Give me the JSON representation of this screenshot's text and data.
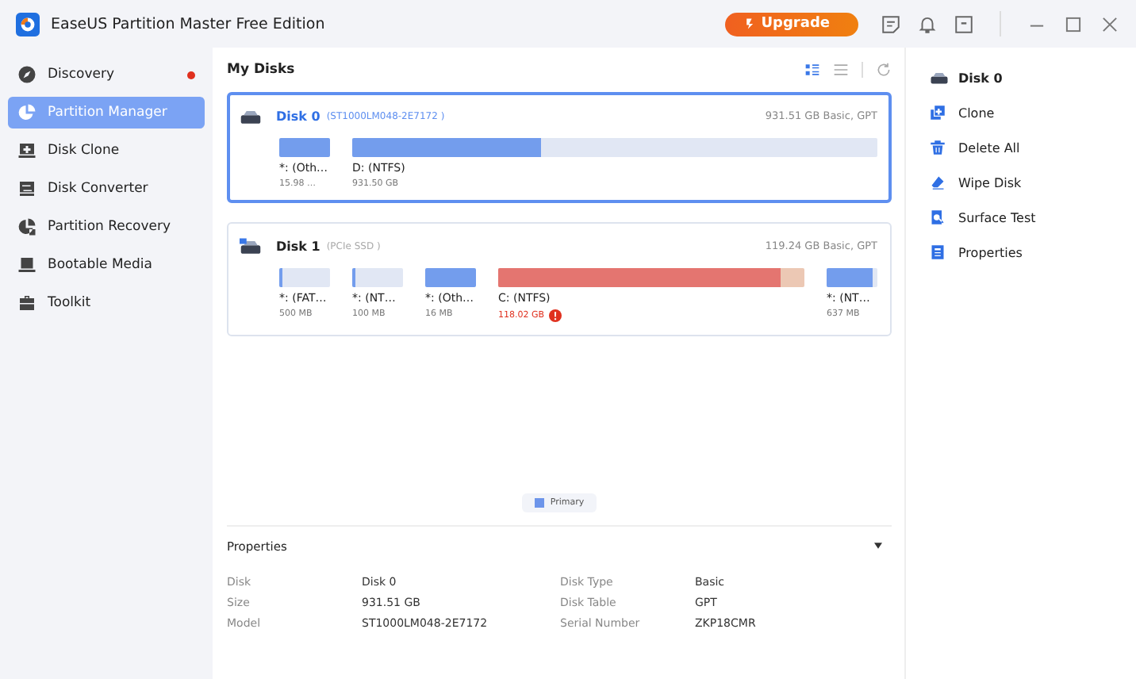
{
  "window": {
    "title": "EaseUS Partition Master Free Edition",
    "upgrade": "Upgrade"
  },
  "sidebar": {
    "items": [
      {
        "label": "Discovery",
        "selected": false,
        "dot": true
      },
      {
        "label": "Partition Manager",
        "selected": true,
        "dot": false
      },
      {
        "label": "Disk Clone",
        "selected": false,
        "dot": false
      },
      {
        "label": "Disk Converter",
        "selected": false,
        "dot": false
      },
      {
        "label": "Partition Recovery",
        "selected": false,
        "dot": false
      },
      {
        "label": "Bootable Media",
        "selected": false,
        "dot": false
      },
      {
        "label": "Toolkit",
        "selected": false,
        "dot": false
      }
    ]
  },
  "main": {
    "title": "My Disks",
    "views": [
      {
        "selected": true
      },
      {
        "selected": false
      }
    ],
    "disks": [
      {
        "name": "Disk 0",
        "detail": "(ST1000LM048-2E7172 )",
        "info": "931.51 GB Basic, GPT",
        "selected": true,
        "partitions": [
          {
            "kind": "small",
            "label": "*: (Oth…",
            "size": "15.98 …",
            "level": 1,
            "warning": false
          },
          {
            "kind": "wide",
            "label": "D: (NTFS)",
            "size": "931.50 GB",
            "level": 0.36,
            "warning": false
          }
        ]
      },
      {
        "name": "Disk 1",
        "detail": "(PCIe SSD )",
        "info": "119.24 GB Basic, GPT",
        "selected": false,
        "partitions": [
          {
            "kind": "small",
            "label": "*: (FAT…",
            "size": "500 MB",
            "level": 0.05,
            "warning": false
          },
          {
            "kind": "small",
            "label": "*: (NT…",
            "size": "100 MB",
            "level": 0.05,
            "warning": false
          },
          {
            "kind": "small",
            "label": "*: (Oth…",
            "size": "16 MB",
            "level": 1,
            "warning": false
          },
          {
            "kind": "wide",
            "label": "C: (NTFS)",
            "size": "118.02 GB",
            "level": 0.92,
            "warning": true
          },
          {
            "kind": "small",
            "label": "*: (NT…",
            "size": "637 MB",
            "level": 0.9,
            "warning": false
          }
        ]
      }
    ],
    "legend": "Primary"
  },
  "properties": {
    "title": "Properties",
    "rows": [
      {
        "label": "Disk",
        "value": "Disk 0",
        "label2": "Disk Type",
        "value2": "Basic"
      },
      {
        "label": "Size",
        "value": "931.51 GB",
        "label2": "Disk Table",
        "value2": "GPT"
      },
      {
        "label": "Model",
        "value": "ST1000LM048-2E7172",
        "label2": "Serial Number",
        "value2": "ZKP18CMR"
      }
    ]
  },
  "actions": {
    "title": "Disk 0",
    "items": [
      "Clone",
      "Delete All",
      "Wipe Disk",
      "Surface Test",
      "Properties"
    ]
  }
}
